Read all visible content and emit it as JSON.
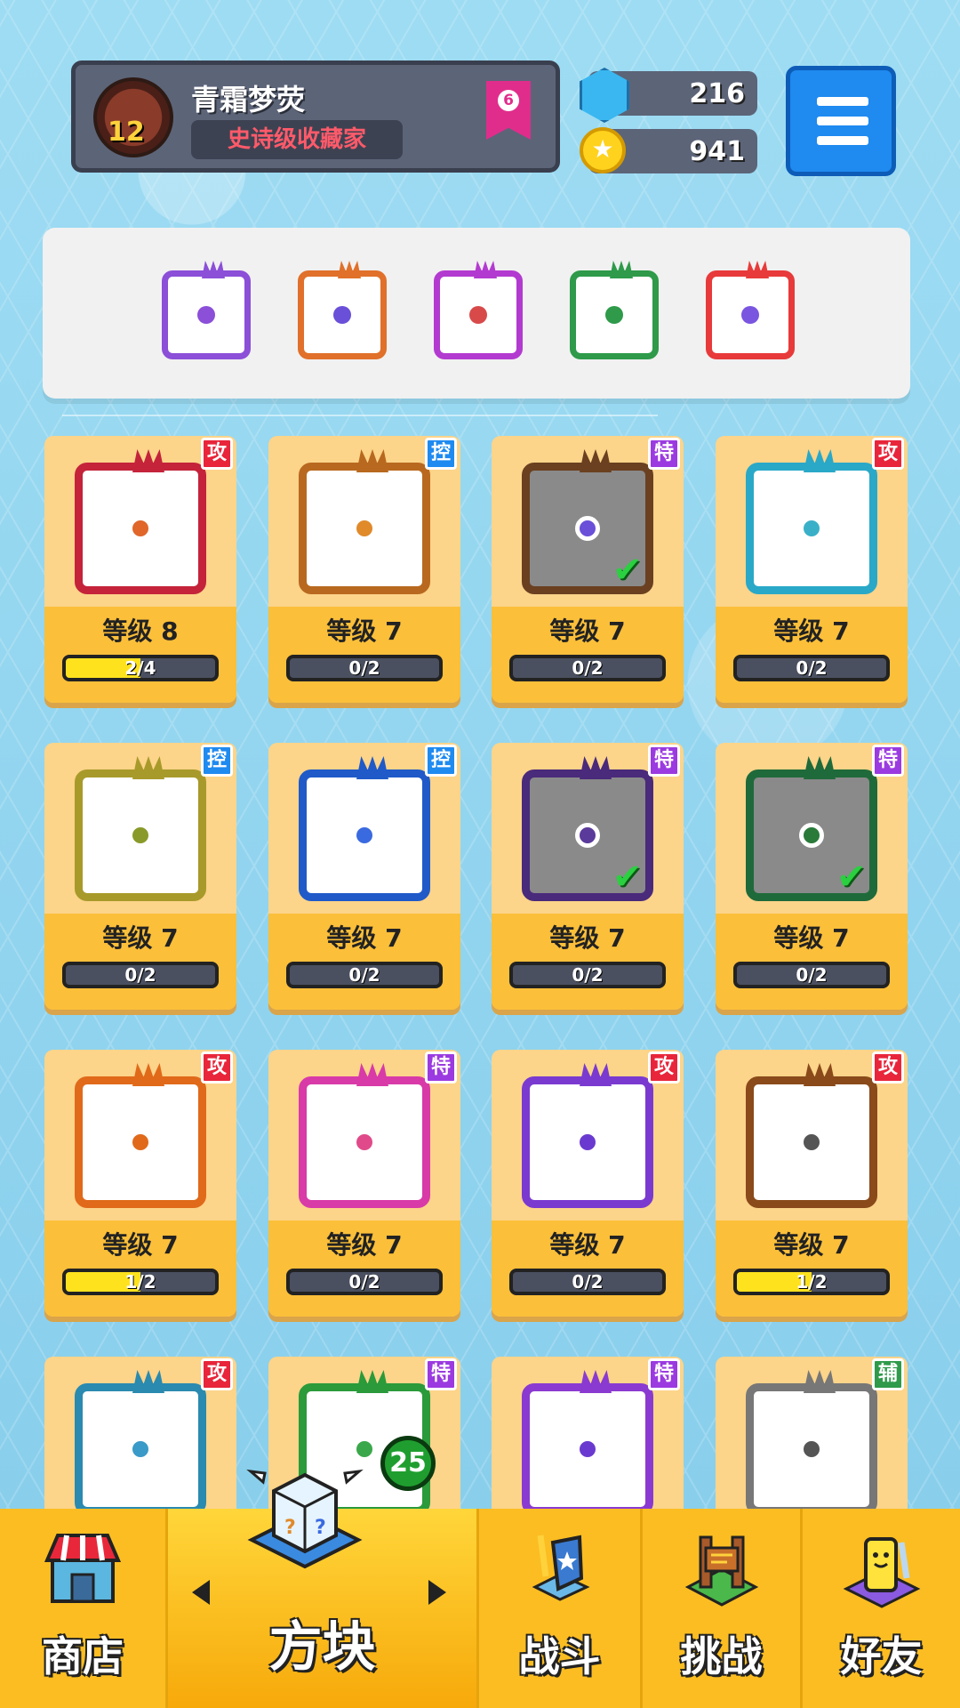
{
  "player": {
    "name": "青霜梦荧",
    "level": "12",
    "title": "史诗级收藏家",
    "rank": "6"
  },
  "currency": {
    "gems": "216",
    "gold": "941"
  },
  "deck": [
    {
      "color": "#8b4fd8",
      "pip": "#8b4fd8"
    },
    {
      "color": "#e0702a",
      "pip": "#6a4fd8"
    },
    {
      "color": "#b33ad0",
      "pip": "#d84a4a"
    },
    {
      "color": "#2e9a4a",
      "pip": "#2e9a4a"
    },
    {
      "color": "#e83a3a",
      "pip": "#7a55e0"
    }
  ],
  "cards": [
    {
      "tag": "攻",
      "tag_color": "#e8253a",
      "border": "#c4233a",
      "pip": "#e0662a",
      "dim": false,
      "check": false,
      "level": "等级 8",
      "progress": "2/4",
      "fill": 0.5
    },
    {
      "tag": "控",
      "tag_color": "#1f8af0",
      "border": "#b8691f",
      "pip": "#e08a2a",
      "dim": false,
      "check": false,
      "level": "等级 7",
      "progress": "0/2",
      "fill": 0
    },
    {
      "tag": "特",
      "tag_color": "#9b3ae0",
      "border": "#6a4020",
      "pip": "#6a4fd8",
      "dim": true,
      "check": true,
      "level": "等级 7",
      "progress": "0/2",
      "fill": 0
    },
    {
      "tag": "攻",
      "tag_color": "#e8253a",
      "border": "#2aa8c8",
      "pip": "#3ab0c8",
      "dim": false,
      "check": false,
      "level": "等级 7",
      "progress": "0/2",
      "fill": 0
    },
    {
      "tag": "控",
      "tag_color": "#1f8af0",
      "border": "#a89a2a",
      "pip": "#8a9a2a",
      "dim": false,
      "check": false,
      "level": "等级 7",
      "progress": "0/2",
      "fill": 0
    },
    {
      "tag": "控",
      "tag_color": "#1f8af0",
      "border": "#1f5ac8",
      "pip": "#3a6ae0",
      "dim": false,
      "check": false,
      "level": "等级 7",
      "progress": "0/2",
      "fill": 0
    },
    {
      "tag": "特",
      "tag_color": "#9b3ae0",
      "border": "#4a2a7a",
      "pip": "#5a3a9a",
      "dim": true,
      "check": true,
      "level": "等级 7",
      "progress": "0/2",
      "fill": 0
    },
    {
      "tag": "特",
      "tag_color": "#9b3ae0",
      "border": "#1f6a3a",
      "pip": "#2a7a3a",
      "dim": true,
      "check": true,
      "level": "等级 7",
      "progress": "0/2",
      "fill": 0
    },
    {
      "tag": "攻",
      "tag_color": "#e8253a",
      "border": "#e06a1a",
      "pip": "#e06a1a",
      "dim": false,
      "check": false,
      "level": "等级 7",
      "progress": "1/2",
      "fill": 0.5
    },
    {
      "tag": "特",
      "tag_color": "#9b3ae0",
      "border": "#d83aa8",
      "pip": "#e04a8a",
      "dim": false,
      "check": false,
      "level": "等级 7",
      "progress": "0/2",
      "fill": 0
    },
    {
      "tag": "攻",
      "tag_color": "#e8253a",
      "border": "#7a3ad0",
      "pip": "#6a3ad0",
      "dim": false,
      "check": false,
      "level": "等级 7",
      "progress": "0/2",
      "fill": 0
    },
    {
      "tag": "攻",
      "tag_color": "#e8253a",
      "border": "#8a4a1a",
      "pip": "#555555",
      "dim": false,
      "check": false,
      "level": "等级 7",
      "progress": "1/2",
      "fill": 0.5
    },
    {
      "tag": "攻",
      "tag_color": "#e8253a",
      "border": "#2a8ab0",
      "pip": "#3a9ac8",
      "dim": false,
      "check": false,
      "level": "",
      "progress": "",
      "fill": 0
    },
    {
      "tag": "特",
      "tag_color": "#9b3ae0",
      "border": "#2a9a3a",
      "pip": "#3aa84a",
      "dim": false,
      "check": false,
      "level": "",
      "progress": "",
      "fill": 0
    },
    {
      "tag": "特",
      "tag_color": "#9b3ae0",
      "border": "#8a3ad0",
      "pip": "#6a3ad0",
      "dim": false,
      "check": false,
      "level": "",
      "progress": "",
      "fill": 0
    },
    {
      "tag": "辅",
      "tag_color": "#2e9a4a",
      "border": "#777777",
      "pip": "#555555",
      "dim": false,
      "check": false,
      "level": "",
      "progress": "",
      "fill": 0
    }
  ],
  "nav": {
    "shop": "商店",
    "dice": "方块",
    "dice_badge": "25",
    "battle": "战斗",
    "challenge": "挑战",
    "friends": "好友"
  }
}
